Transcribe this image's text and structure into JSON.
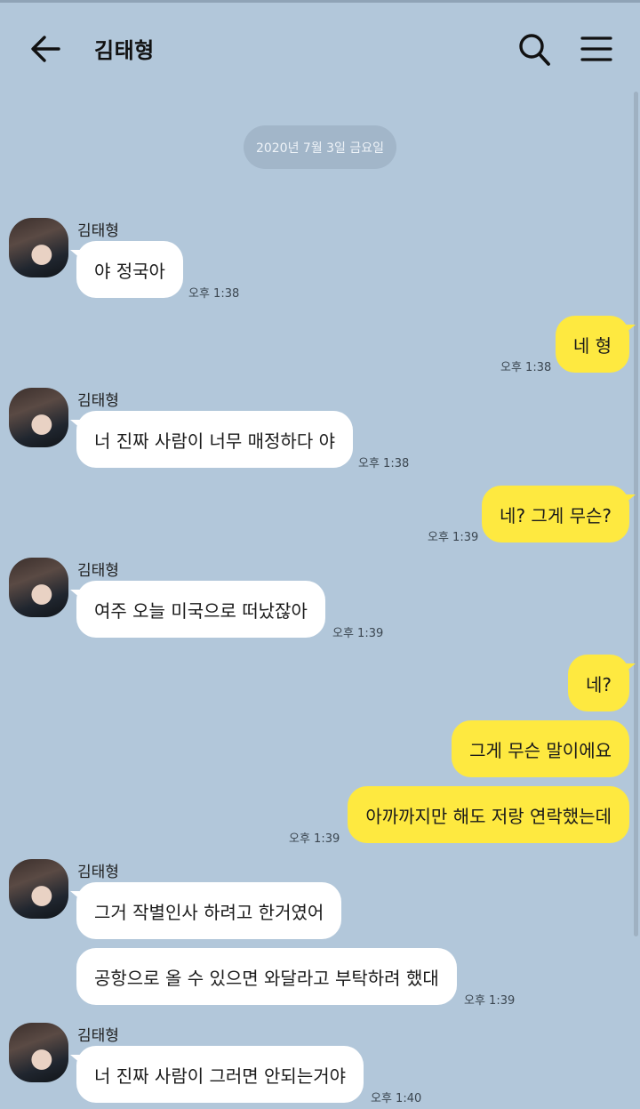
{
  "header": {
    "title": "김태형",
    "icons": {
      "back": "arrow-left-icon",
      "search": "search-icon",
      "menu": "hamburger-menu-icon"
    }
  },
  "date_divider": "2020년 7월 3일 금요일",
  "colors": {
    "background": "#b2c7da",
    "incoming_bubble": "#ffffff",
    "outgoing_bubble": "#fee940",
    "date_pill": "#a2b6c9"
  },
  "messages": [
    {
      "side": "in",
      "sender": "김태형",
      "text": "야 정국아",
      "time": "오후 1:38"
    },
    {
      "side": "out",
      "text": "네 형",
      "time": "오후 1:38"
    },
    {
      "side": "in",
      "sender": "김태형",
      "text": "너 진짜 사람이 너무 매정하다 야",
      "time": "오후 1:38"
    },
    {
      "side": "out",
      "text": "네? 그게 무슨?",
      "time": "오후 1:39"
    },
    {
      "side": "in",
      "sender": "김태형",
      "text": "여주 오늘 미국으로 떠났잖아",
      "time": "오후 1:39"
    },
    {
      "side": "out",
      "text": "네?"
    },
    {
      "side": "out",
      "text": "그게 무슨 말이에요"
    },
    {
      "side": "out",
      "text": "아까까지만 해도 저랑 연락했는데",
      "time": "오후 1:39"
    },
    {
      "side": "in",
      "sender": "김태형",
      "text": "그거 작별인사 하려고 한거였어"
    },
    {
      "side": "in",
      "text": "공항으로 올 수 있으면 와달라고 부탁하려 했대",
      "time": "오후 1:39"
    },
    {
      "side": "in",
      "sender": "김태형",
      "text": "너 진짜 사람이 그러면 안되는거야",
      "time": "오후 1:40"
    }
  ]
}
